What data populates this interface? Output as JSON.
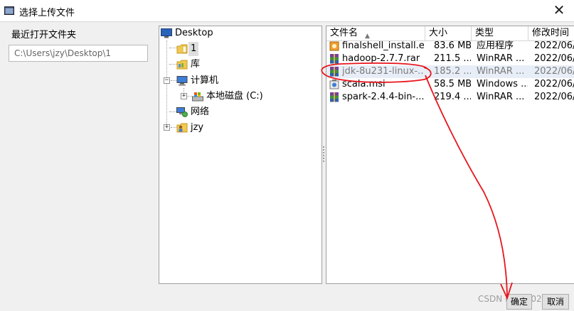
{
  "window": {
    "title": "选择上传文件",
    "close_glyph": "✕"
  },
  "recent": {
    "label": "最近打开文件夹",
    "path": "C:\\Users\\jzy\\Desktop\\1"
  },
  "tree": {
    "root": "Desktop",
    "items": [
      {
        "label": "1"
      },
      {
        "label": "库"
      },
      {
        "label": "计算机"
      },
      {
        "label": "本地磁盘 (C:)"
      },
      {
        "label": "网络"
      },
      {
        "label": "jzy"
      }
    ],
    "expand_glyph": "+",
    "collapse_glyph": "−"
  },
  "list": {
    "columns": [
      {
        "label": "文件名"
      },
      {
        "label": "大小"
      },
      {
        "label": "类型"
      },
      {
        "label": "修改时间"
      }
    ],
    "sort_glyph": "▲",
    "files": [
      {
        "name": "finalshell_install.e...",
        "size": "83.6 MB",
        "type": "应用程序",
        "modified": "2022/06/"
      },
      {
        "name": "hadoop-2.7.7.rar",
        "size": "211.5 ...",
        "type": "WinRAR ...",
        "modified": "2022/06/"
      },
      {
        "name": "jdk-8u231-linux-...",
        "size": "185.2 ...",
        "type": "WinRAR ...",
        "modified": "2022/06/"
      },
      {
        "name": "scala.msi",
        "size": "58.5 MB",
        "type": "Windows ...",
        "modified": "2022/06/"
      },
      {
        "name": "spark-2.4.4-bin-...",
        "size": "219.4 ...",
        "type": "WinRAR ...",
        "modified": "2022/06/"
      }
    ]
  },
  "buttons": {
    "ok": "确定",
    "cancel": "取消"
  },
  "watermark": "CSDN @jzy2023",
  "colors": {
    "annotation": "#e8141c",
    "selection": "#dedede",
    "row_hover": "#e8eef7"
  }
}
